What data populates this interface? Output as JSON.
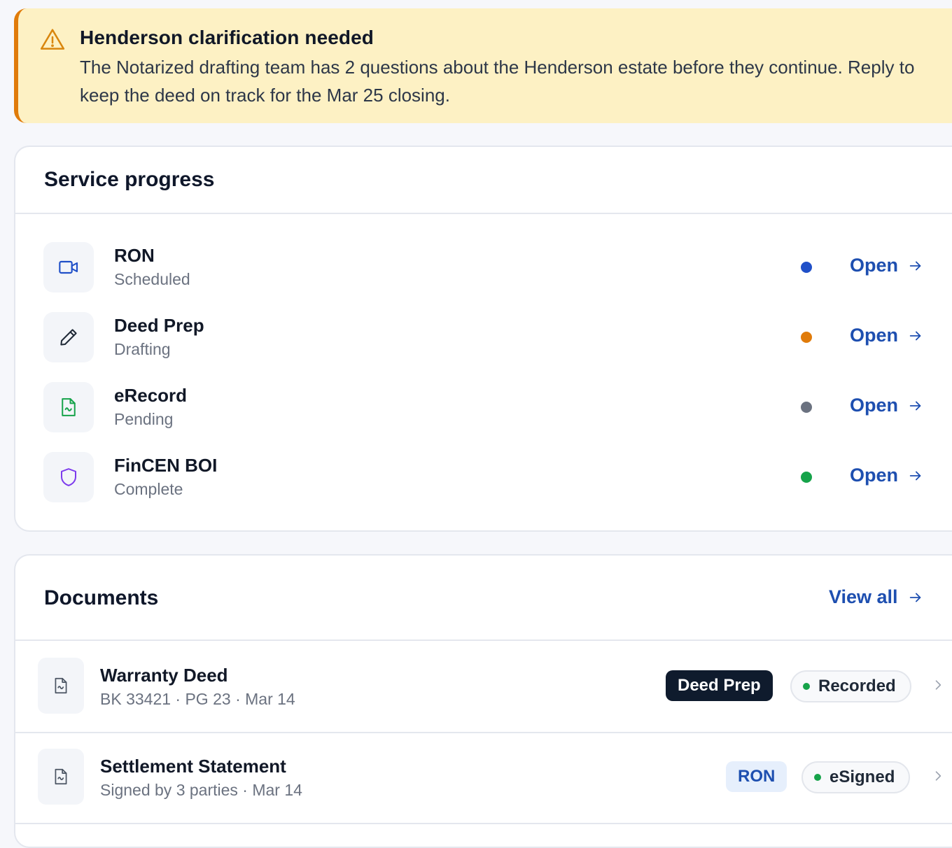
{
  "alert": {
    "title": "Henderson clarification needed",
    "body": "The Notarized drafting team has 2 questions about the Henderson estate before they continue. Reply to keep the deed on track for the Mar 25 closing.",
    "icon": "warning-icon",
    "accent": "#e07b0a",
    "background": "#fdf1c4"
  },
  "service_progress": {
    "title": "Service progress",
    "open_label": "Open",
    "items": [
      {
        "name": "RON",
        "status": "Scheduled",
        "icon": "video-icon",
        "dot_color": "#2050c8"
      },
      {
        "name": "Deed Prep",
        "status": "Drafting",
        "icon": "pencil-icon",
        "dot_color": "#e07b0a"
      },
      {
        "name": "eRecord",
        "status": "Pending",
        "icon": "document-icon",
        "dot_color": "#6b7280"
      },
      {
        "name": "FinCEN BOI",
        "status": "Complete",
        "icon": "shield-icon",
        "dot_color": "#16a34a"
      }
    ]
  },
  "documents": {
    "title": "Documents",
    "view_all_label": "View all",
    "items": [
      {
        "name": "Warranty Deed",
        "meta": "BK 33421 · PG 23 · Mar 14",
        "tag": "Deed Prep",
        "status": "Recorded"
      },
      {
        "name": "Settlement Statement",
        "meta": "Signed by 3 parties · Mar 14",
        "tag": "RON",
        "status": "eSigned"
      }
    ]
  }
}
